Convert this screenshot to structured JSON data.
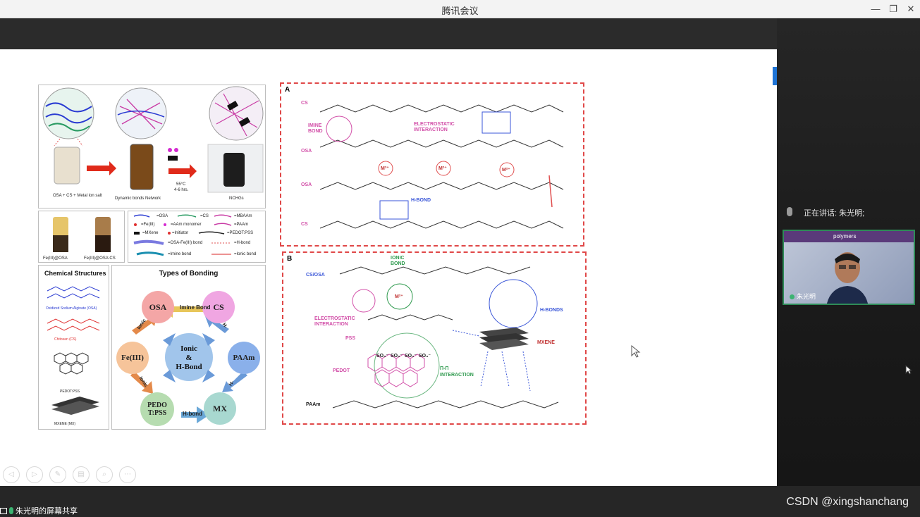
{
  "window": {
    "title": "腾讯会议",
    "minimize": "—",
    "restore": "❐",
    "close": "✕"
  },
  "speaker": {
    "label": "正在讲话: 朱光明;"
  },
  "video": {
    "name": "朱光明",
    "strip_text": "polymers"
  },
  "share_badge": {
    "label": "朱光明的屏幕共享"
  },
  "watermark": "CSDN @xingshanchang",
  "slide_left": {
    "row1": [
      "OSA + CS + Metal ion salt",
      "Dynamic bonds Network",
      "NCHGs",
      "55°C",
      "4-6 hrs."
    ],
    "row2": [
      "Fe(III)@OSA",
      "Fe(III)@OSA:CS"
    ],
    "legend": [
      "=OSA",
      "=CS",
      "=MBAAm",
      "=Fe(III)",
      "=AAm monomer",
      "=PAAm",
      "=MXene",
      "=Initiator",
      "=PEDOT:PSS",
      "=OSA-Fe(III) bond",
      "=H-bond",
      "=Imine bond",
      "=Ionic bond"
    ],
    "chem_title": "Chemical Structures",
    "chem_items": [
      "Oxidized Sodium Alginate (OSA)",
      "Chitosan (CS)",
      "PEDOT:PSS",
      "MXENE (MX)"
    ],
    "bond_title": "Types of Bonding",
    "bond_nodes": [
      "OSA",
      "CS",
      "Fe(III)",
      "PAAm",
      "PEDO T:PSS",
      "MX"
    ],
    "bond_center": [
      "Ionic",
      "&",
      "H-Bond"
    ],
    "bond_arrows": [
      "Imine Bond",
      "Ionic",
      "H-",
      "Ionic",
      "H-",
      "H-bond"
    ]
  },
  "panelA": {
    "letter": "A",
    "labels": [
      "CS",
      "OSA",
      "OSA",
      "CS",
      "IMINE BOND",
      "ELECTROSTATIC INTERACTION",
      "H-BOND",
      "M²⁺",
      "M²⁺",
      "M²⁺"
    ]
  },
  "panelB": {
    "letter": "B",
    "labels": [
      "CS/OSA",
      "IONIC BOND",
      "H-BONDS",
      "ELECTROSTATIC INTERACTION",
      "PSS",
      "MXENE",
      "PEDOT",
      "Π-Π INTERACTION",
      "PAAm",
      "SO₃⁻",
      "SO₃⁻",
      "SO₃⁻",
      "SO₃⁻",
      "M²⁺"
    ]
  }
}
